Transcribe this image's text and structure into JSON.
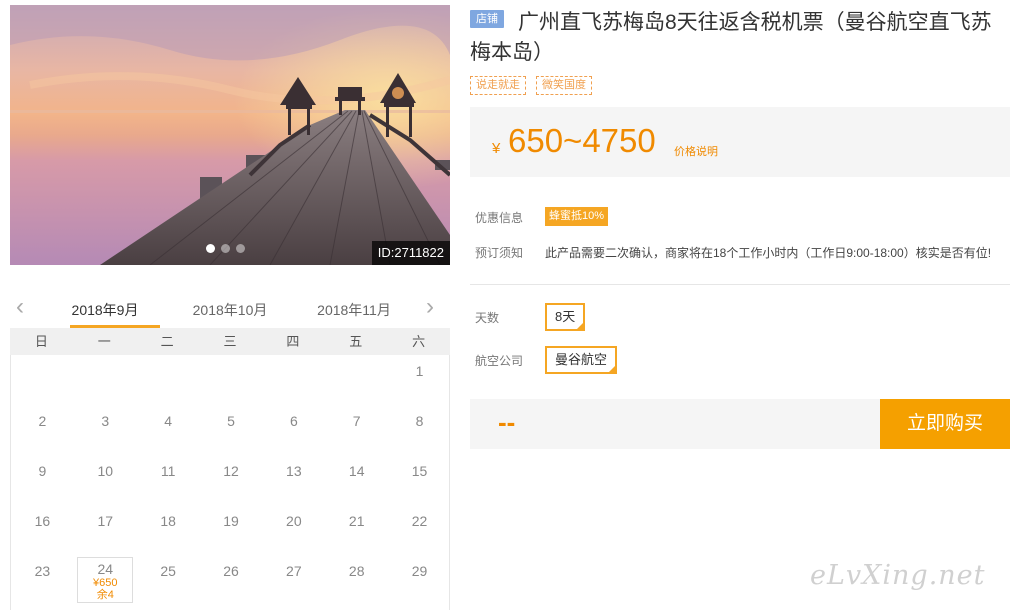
{
  "hero": {
    "photo_id": "ID:2711822",
    "slide_count": 3,
    "active_slide": 1
  },
  "calendar": {
    "months": [
      "2018年9月",
      "2018年10月",
      "2018年11月"
    ],
    "active_month": 0,
    "weekdays": [
      "日",
      "一",
      "二",
      "三",
      "四",
      "五",
      "六"
    ],
    "days": [
      [
        "",
        "",
        "",
        "",
        "",
        "",
        "1"
      ],
      [
        "2",
        "3",
        "4",
        "5",
        "6",
        "7",
        "8"
      ],
      [
        "9",
        "10",
        "11",
        "12",
        "13",
        "14",
        "15"
      ],
      [
        "16",
        "17",
        "18",
        "19",
        "20",
        "21",
        "22"
      ],
      [
        "23",
        "24",
        "25",
        "26",
        "27",
        "28",
        "29"
      ]
    ],
    "selected": {
      "day": "24",
      "price": "¥650",
      "remain": "余4"
    }
  },
  "product": {
    "shop_tag": "店铺",
    "title": "广州直飞苏梅岛8天往返含税机票（曼谷航空直飞苏梅本岛）",
    "feature_tags": [
      "说走就走",
      "微笑国度"
    ],
    "price_symbol": "¥",
    "price_range": "650~4750",
    "price_note": "价格说明",
    "promo_label": "优惠信息",
    "promo_badge": "蜂蜜抵10%",
    "notice_label": "预订须知",
    "notice_text": "此产品需要二次确认，商家将在18个工作小时内（工作日9:00-18:00）核实是否有位!",
    "days_label": "天数",
    "days_value": "8天",
    "airline_label": "航空公司",
    "airline_value": "曼谷航空",
    "total_placeholder": "--",
    "buy_label": "立即购买"
  },
  "colors": {
    "accent": "#f5a623",
    "price": "#f08a00",
    "shop_tag": "#7fa7e0"
  },
  "watermark": "eLvXing.net"
}
